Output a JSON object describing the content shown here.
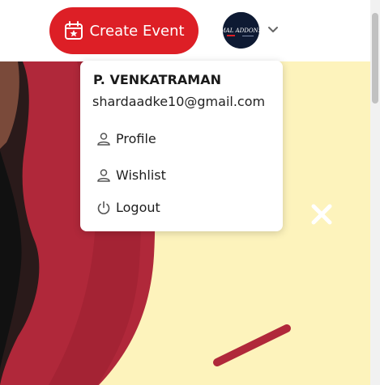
{
  "header": {
    "create_event_label": "Create Event",
    "brand_color": "#dd1f26",
    "avatar_text": "MAL ADDONS",
    "icons": [
      "calendar-star-icon",
      "chevron-down-icon"
    ]
  },
  "dropdown": {
    "user_name": "P. VENKATRAMAN",
    "user_email": "shardaadke10@gmail.com",
    "items": [
      {
        "label": "Profile",
        "icon": "user-icon"
      },
      {
        "label": "Wishlist",
        "icon": "user-icon"
      },
      {
        "label": "Logout",
        "icon": "power-icon"
      }
    ]
  },
  "hero": {
    "background_color": "#fdf3bc",
    "accent_color": "#b0283a",
    "decor_icons": [
      "close-icon"
    ]
  }
}
